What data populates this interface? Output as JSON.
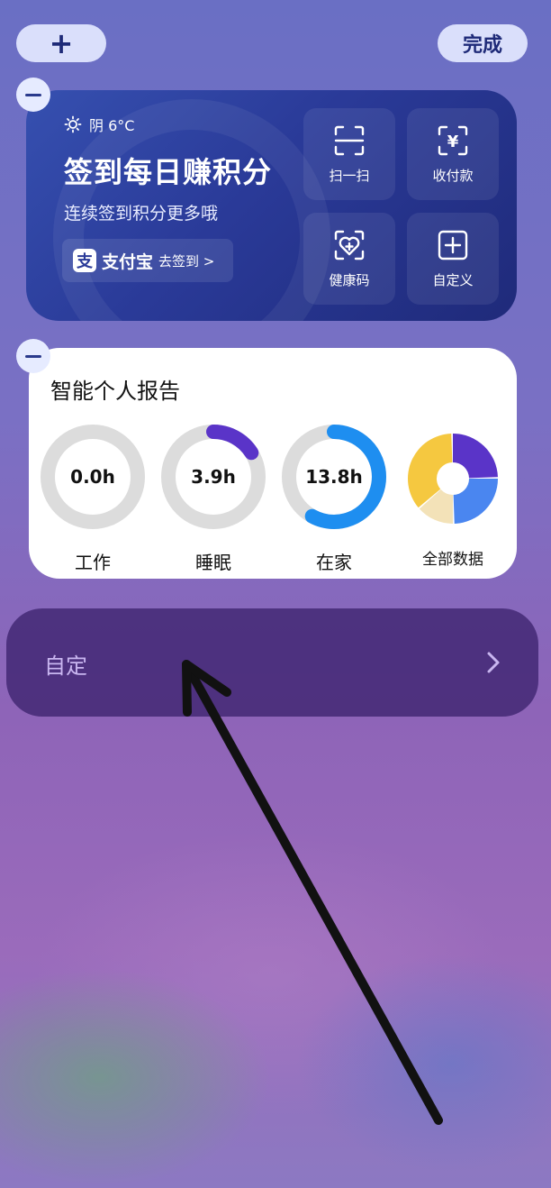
{
  "top": {
    "add_label": "+",
    "done_label": "完成"
  },
  "alipay": {
    "weather": "阴 6°C",
    "title": "签到每日赚积分",
    "subtitle": "连续签到积分更多哦",
    "logo_glyph": "支",
    "brand": "支付宝",
    "checkin": "去签到 >",
    "tiles": [
      {
        "label": "扫一扫",
        "icon": "scan-icon"
      },
      {
        "label": "收付款",
        "icon": "payment-icon"
      },
      {
        "label": "健康码",
        "icon": "health-code-icon"
      },
      {
        "label": "自定义",
        "icon": "plus-square-icon"
      }
    ]
  },
  "report": {
    "title": "智能个人报告",
    "rings": [
      {
        "value": "0.0h",
        "label": "工作",
        "fraction": 0.0,
        "color": "#5a34c8"
      },
      {
        "value": "3.9h",
        "label": "睡眠",
        "fraction": 0.16,
        "color": "#5a34c8"
      },
      {
        "value": "13.8h",
        "label": "在家",
        "fraction": 0.58,
        "color": "#1e8ef0"
      }
    ],
    "all_data_label": "全部数据",
    "donut_colors": [
      "#5a34c8",
      "#4a86f0",
      "#f3e2b8",
      "#f5c840"
    ]
  },
  "custom": {
    "label": "自定",
    "chevron": ">"
  },
  "colors": {
    "ring_track": "#dcdcdc",
    "annotation_arrow": "#111111"
  }
}
